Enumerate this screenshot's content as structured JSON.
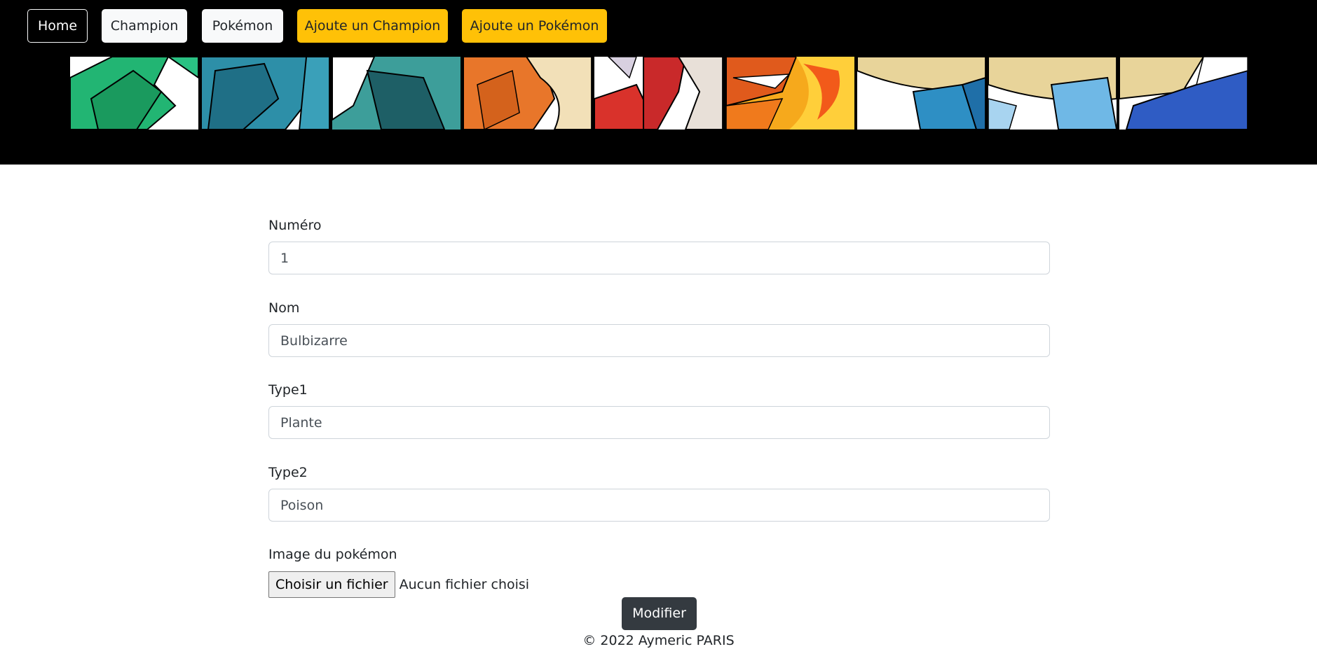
{
  "nav": {
    "home": "Home",
    "champion": "Champion",
    "pokemon": "Pokémon",
    "add_champion": "Ajoute un Champion",
    "add_pokemon": "Ajoute un Pokémon"
  },
  "form": {
    "numero_label": "Numéro",
    "numero_value": "1",
    "nom_label": "Nom",
    "nom_value": "Bulbizarre",
    "type1_label": "Type1",
    "type1_value": "Plante",
    "type2_label": "Type2",
    "type2_value": "Poison",
    "image_label": "Image du pokémon",
    "file_button": "Choisir un fichier",
    "file_status": "Aucun fichier choisi",
    "submit": "Modifier"
  },
  "footer": {
    "text": "© 2022 Aymeric PARIS"
  },
  "colors": {
    "header_bg": "#000000",
    "warning": "#ffc107",
    "light": "#f8f9fa",
    "dark_button": "#343a40"
  }
}
